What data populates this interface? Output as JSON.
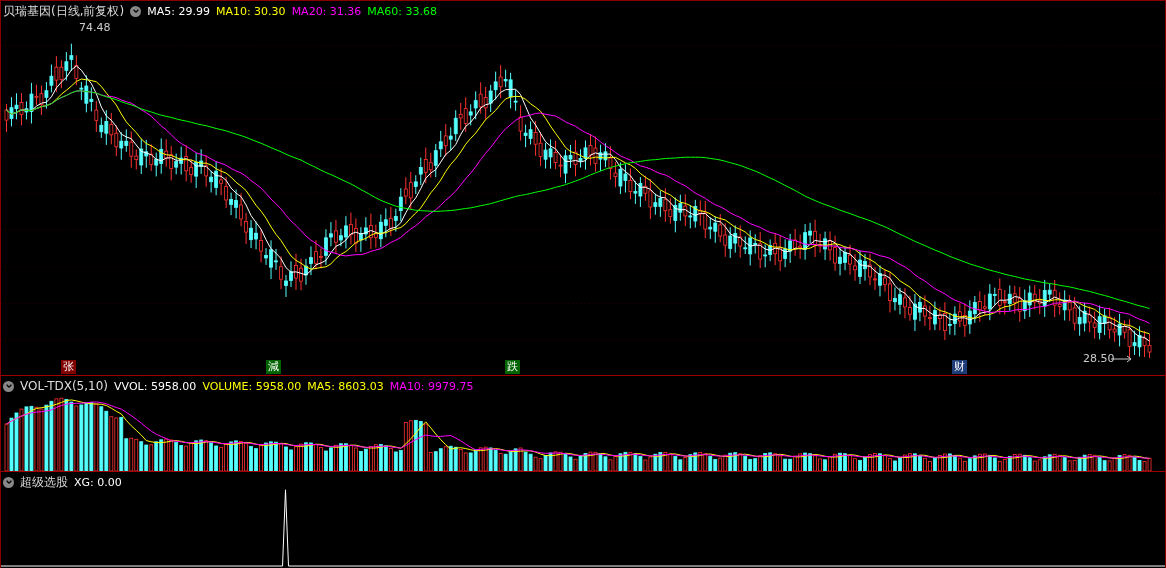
{
  "main_panel": {
    "title": "贝瑞基因(日线,前复权)",
    "legend": [
      {
        "label": "MA5: 29.99",
        "color": "#ffffff"
      },
      {
        "label": "MA10: 30.30",
        "color": "#ffff00"
      },
      {
        "label": "MA20: 31.36",
        "color": "#ff00ff"
      },
      {
        "label": "MA60: 33.68",
        "color": "#00ff00"
      }
    ],
    "high_label": "74.48",
    "low_label": "28.50",
    "markers": [
      {
        "text": "张",
        "color": "#800000"
      },
      {
        "text": "減",
        "color": "#006400"
      },
      {
        "text": "跌",
        "color": "#006400"
      },
      {
        "text": "财",
        "color": "#1e3c78"
      }
    ]
  },
  "volume_panel": {
    "title": "VOL-TDX(5,10)",
    "legend": [
      {
        "label": "VVOL: 5958.00",
        "color": "#ffffff"
      },
      {
        "label": "VOLUME: 5958.00",
        "color": "#ffff00"
      },
      {
        "label": "MA5: 8603.03",
        "color": "#ffff00"
      },
      {
        "label": "MA10: 9979.75",
        "color": "#ff00ff"
      }
    ]
  },
  "indicator_panel": {
    "title": "超级选股",
    "legend": [
      {
        "label": "XG: 0.00",
        "color": "#ffffff"
      }
    ]
  }
}
